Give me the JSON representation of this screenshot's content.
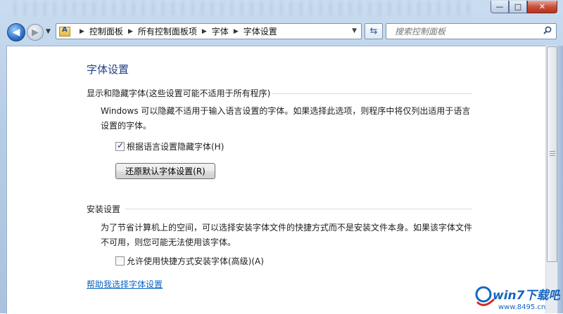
{
  "window": {
    "minimize_glyph": "—",
    "maximize_glyph": "□",
    "close_glyph": "✕"
  },
  "nav": {
    "back_icon": "arrow-left-icon",
    "forward_icon": "arrow-right-icon",
    "breadcrumbs": [
      "控制面板",
      "所有控制面板项",
      "字体",
      "字体设置"
    ],
    "search_placeholder": "搜索控制面板"
  },
  "page": {
    "title": "字体设置",
    "section1": {
      "heading": "显示和隐藏字体(这些设置可能不适用于所有程序)",
      "description": "Windows 可以隐藏不适用于输入语言设置的字体。如果选择此选项，则程序中将仅列出适用于语言设置的字体。",
      "checkbox_label": "根据语言设置隐藏字体(H)",
      "checkbox_checked": true,
      "button_label": "还原默认字体设置(R)"
    },
    "section2": {
      "heading": "安装设置",
      "description": "为了节省计算机上的空间，可以选择安装字体文件的快捷方式而不是安装文件本身。如果该字体文件不可用，则您可能无法使用该字体。",
      "checkbox_label": "允许使用快捷方式安装字体(高级)(A)",
      "checkbox_checked": false
    },
    "help_link": "帮助我选择字体设置"
  },
  "watermark": {
    "brand": "win7下载吧",
    "url": "www.8495.cn"
  },
  "colors": {
    "title_blue": "#1e3f87",
    "link_blue": "#0b63c4",
    "watermark_blue": "#1565c0",
    "watermark_red": "#d12a1f"
  }
}
